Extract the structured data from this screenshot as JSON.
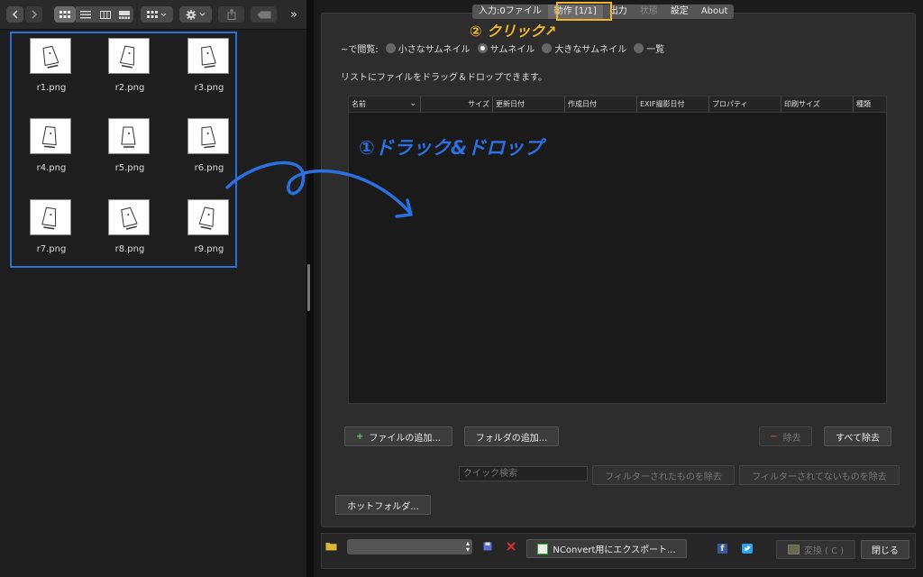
{
  "finder": {
    "files": [
      {
        "name": "r1.png"
      },
      {
        "name": "r2.png"
      },
      {
        "name": "r3.png"
      },
      {
        "name": "r4.png"
      },
      {
        "name": "r5.png"
      },
      {
        "name": "r6.png"
      },
      {
        "name": "r7.png"
      },
      {
        "name": "r8.png"
      },
      {
        "name": "r9.png"
      }
    ],
    "more_label": "»"
  },
  "tabs": [
    {
      "label": "入力:0ファイル"
    },
    {
      "label": "動作 [1/1]"
    },
    {
      "label": "出力"
    },
    {
      "label": "状態"
    },
    {
      "label": "設定"
    },
    {
      "label": "About"
    }
  ],
  "view": {
    "label": "~で閲覧:",
    "options": [
      {
        "label": "小さなサムネイル"
      },
      {
        "label": "サムネイル"
      },
      {
        "label": "大きなサムネイル"
      },
      {
        "label": "一覧"
      }
    ]
  },
  "hint": "リストにファイルをドラッグ＆ドロップできます。",
  "table": {
    "columns": [
      "名前",
      "サイズ",
      "更新日付",
      "作成日付",
      "EXIF撮影日付",
      "プロパティ",
      "印刷サイズ",
      "種類"
    ]
  },
  "buttons": {
    "add_file": "ファイルの追加...",
    "add_folder": "フォルダの追加...",
    "remove": "除去",
    "remove_all": "すべて除去",
    "remove_filtered": "フィルターされたものを除去",
    "remove_unfiltered": "フィルターされてないものを除去",
    "hot_folder": "ホットフォルダ...",
    "export": "NConvert用にエクスポート...",
    "convert": "変換 ( C )",
    "close": "閉じる"
  },
  "search": {
    "placeholder": "クイック検索"
  },
  "annotations": {
    "step1": "①ドラック&ドロップ",
    "step2": "② クリック↗"
  },
  "colors": {
    "highlight": "#f0b428",
    "annotation_blue": "#2b6fe0",
    "selection": "#2c6fd6"
  }
}
